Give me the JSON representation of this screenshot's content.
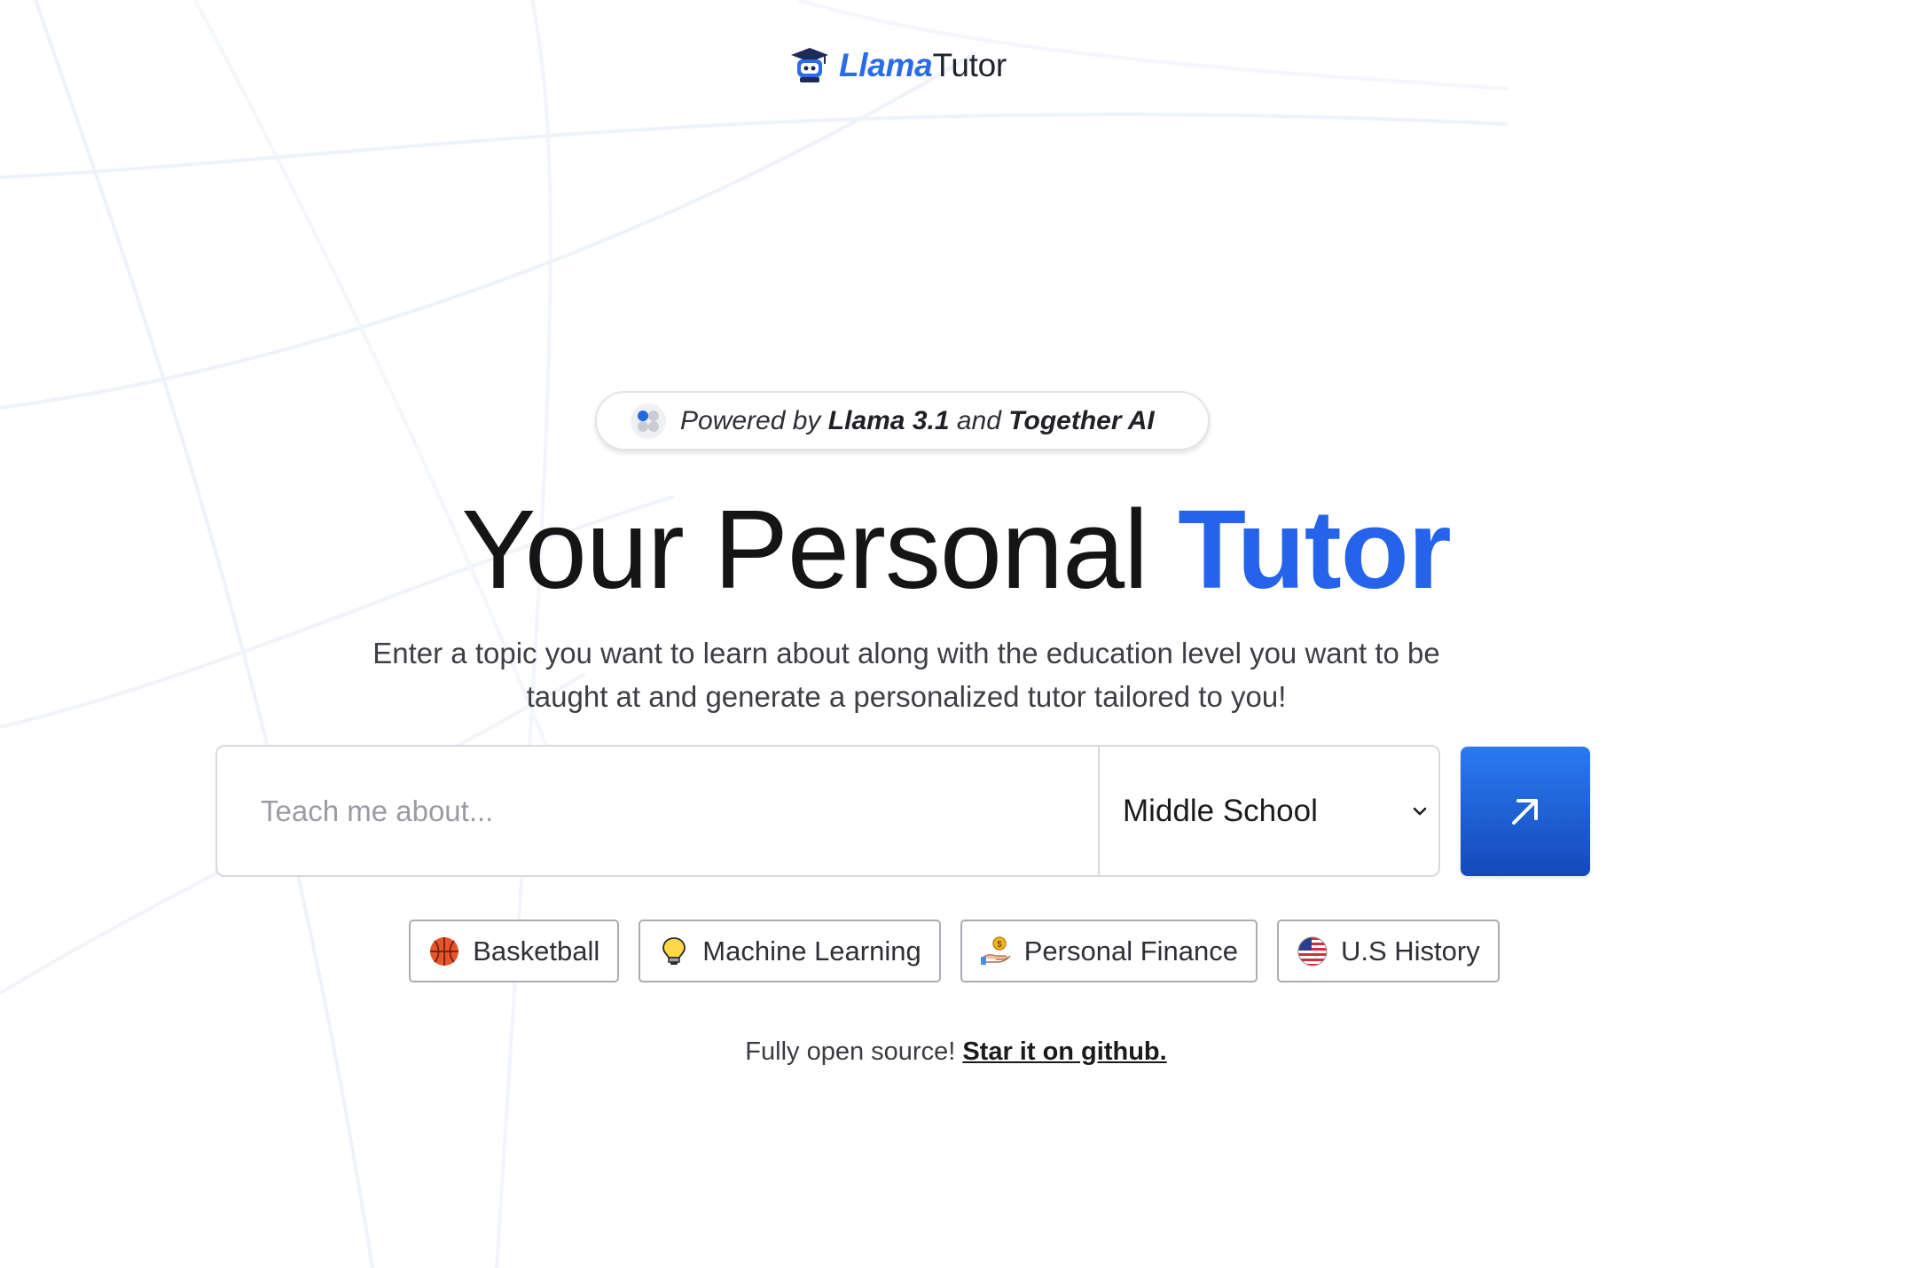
{
  "header": {
    "logo_part1": "Llama",
    "logo_part2": "Tutor",
    "logo_icon": "robot-graduate-icon"
  },
  "badge": {
    "prefix": "Powered by",
    "model": "Llama 3.1",
    "conjunction": "and",
    "provider": "Together AI",
    "icon": "together-ai-icon"
  },
  "hero": {
    "title_plain": "Your Personal ",
    "title_accent": "Tutor",
    "subtitle": "Enter a topic you want to learn about along with the education level you want to be taught at and generate a personalized tutor tailored to you!"
  },
  "search": {
    "placeholder": "Teach me about...",
    "value": "",
    "level_selected": "Middle School",
    "submit_icon": "arrow-up-right-icon"
  },
  "suggestions": [
    {
      "label": "Basketball",
      "icon": "basketball-icon"
    },
    {
      "label": "Machine Learning",
      "icon": "lightbulb-icon"
    },
    {
      "label": "Personal Finance",
      "icon": "money-hand-icon"
    },
    {
      "label": "U.S History",
      "icon": "us-flag-icon"
    }
  ],
  "footer": {
    "text": "Fully open source!",
    "link": "Star it on github."
  },
  "colors": {
    "accent": "#2563eb",
    "button_top": "#2a7af2",
    "button_bottom": "#1549b8"
  }
}
